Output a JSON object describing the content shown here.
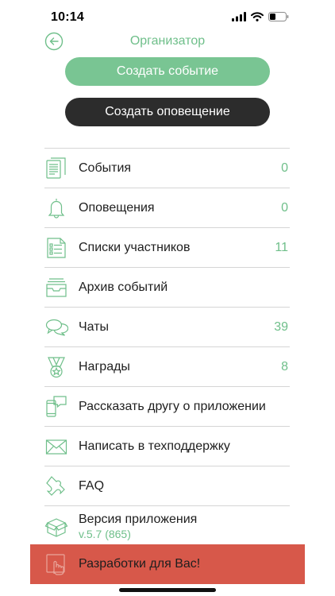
{
  "status": {
    "time": "10:14"
  },
  "header": {
    "title": "Организатор"
  },
  "buttons": {
    "create_event": "Создать событие",
    "create_notification": "Создать оповещение"
  },
  "menu": [
    {
      "label": "События",
      "count": "0",
      "icon": "document-icon"
    },
    {
      "label": "Оповещения",
      "count": "0",
      "icon": "bell-icon"
    },
    {
      "label": "Списки участников",
      "count": "11",
      "icon": "checklist-icon"
    },
    {
      "label": "Архив событий",
      "count": "",
      "icon": "archive-icon"
    },
    {
      "label": "Чаты",
      "count": "39",
      "icon": "chat-icon"
    },
    {
      "label": "Награды",
      "count": "8",
      "icon": "medal-icon"
    },
    {
      "label": "Рассказать другу о приложении",
      "count": "",
      "icon": "share-phone-icon"
    },
    {
      "label": "Написать в техподдержку",
      "count": "",
      "icon": "envelope-icon"
    },
    {
      "label": "FAQ",
      "count": "",
      "icon": "puzzle-icon"
    }
  ],
  "version": {
    "label": "Версия приложения",
    "value": "v.5.7 (865)"
  },
  "developments": {
    "label": "Разработки для Вас!"
  },
  "colors": {
    "accent": "#6fbf8a",
    "button_green": "#79c593",
    "button_dark": "#2c2c2c",
    "banner_red": "#d7584a"
  }
}
